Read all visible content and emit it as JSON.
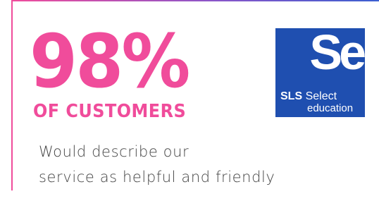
{
  "stat": {
    "value": "98%",
    "label": "OF CUSTOMERS",
    "description_line1": "Would describe our",
    "description_line2": "service as helpful and friendly"
  },
  "logo": {
    "mark": "Se",
    "brand_bold": "SLS",
    "brand_light": "Select",
    "brand_line2": "education"
  },
  "colors": {
    "accent_pink": "#f04c9b",
    "logo_blue": "#1f4fb0",
    "text_gray": "#444444"
  }
}
